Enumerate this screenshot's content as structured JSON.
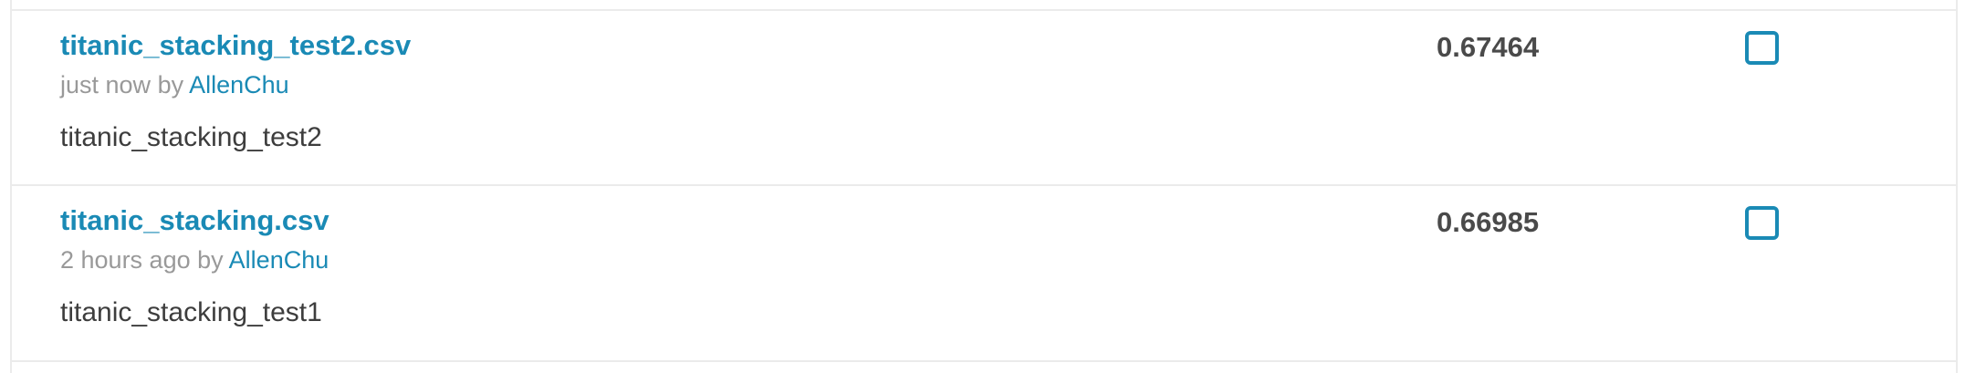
{
  "submissions": [
    {
      "file_name": "titanic_stacking_test2.csv",
      "time": "just now",
      "by": "by",
      "author": "AllenChu",
      "description": "titanic_stacking_test2",
      "score": "0.67464"
    },
    {
      "file_name": "titanic_stacking.csv",
      "time": "2 hours ago",
      "by": "by",
      "author": "AllenChu",
      "description": "titanic_stacking_test1",
      "score": "0.66985"
    }
  ],
  "colors": {
    "link": "#1a8ab5",
    "muted": "#999999",
    "text": "#3d3d3d",
    "score": "#4a4a4a",
    "divider": "#ebebeb"
  }
}
